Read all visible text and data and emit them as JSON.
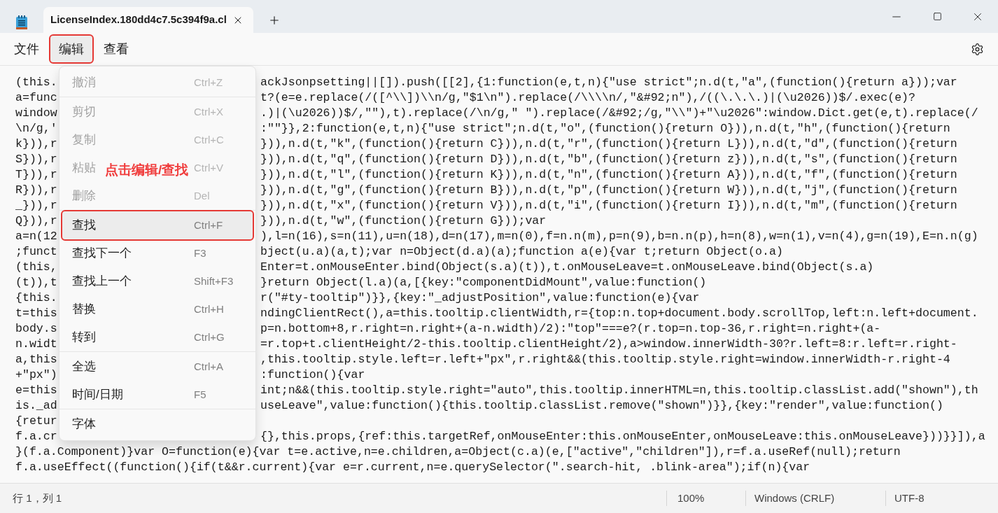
{
  "window": {
    "tab_title": "LicenseIndex.180dd4c7.5c394f9a.cl"
  },
  "menu_bar": [
    {
      "label": "文件",
      "selected": false,
      "annotated": false
    },
    {
      "label": "编辑",
      "selected": true,
      "annotated": true
    },
    {
      "label": "查看",
      "selected": false,
      "annotated": false
    }
  ],
  "edit_menu": {
    "groups": [
      [
        {
          "label": "撤消",
          "shortcut": "Ctrl+Z",
          "disabled": true,
          "selected": false,
          "annotated": false
        }
      ],
      [
        {
          "label": "剪切",
          "shortcut": "Ctrl+X",
          "disabled": true,
          "selected": false,
          "annotated": false
        },
        {
          "label": "复制",
          "shortcut": "Ctrl+C",
          "disabled": true,
          "selected": false,
          "annotated": false
        },
        {
          "label": "粘贴",
          "shortcut": "Ctrl+V",
          "disabled": true,
          "selected": false,
          "annotated": false
        },
        {
          "label": "删除",
          "shortcut": "Del",
          "disabled": true,
          "selected": false,
          "annotated": false
        }
      ],
      [
        {
          "label": "查找",
          "shortcut": "Ctrl+F",
          "disabled": false,
          "selected": true,
          "annotated": true
        },
        {
          "label": "查找下一个",
          "shortcut": "F3",
          "disabled": false,
          "selected": false,
          "annotated": false
        },
        {
          "label": "查找上一个",
          "shortcut": "Shift+F3",
          "disabled": false,
          "selected": false,
          "annotated": false
        },
        {
          "label": "替换",
          "shortcut": "Ctrl+H",
          "disabled": false,
          "selected": false,
          "annotated": false
        },
        {
          "label": "转到",
          "shortcut": "Ctrl+G",
          "disabled": false,
          "selected": false,
          "annotated": false
        }
      ],
      [
        {
          "label": "全选",
          "shortcut": "Ctrl+A",
          "disabled": false,
          "selected": false,
          "annotated": false
        },
        {
          "label": "时间/日期",
          "shortcut": "F5",
          "disabled": false,
          "selected": false,
          "annotated": false
        }
      ],
      [
        {
          "label": "字体",
          "disabled": false,
          "selected": false,
          "annotated": false
        }
      ]
    ]
  },
  "annotation": "点击编辑/查找",
  "editor_lines": [
    {
      "kind": "split",
      "left": "(this.",
      "right": "ackJsonpsetting||[]).push([[2],{1:function(e,t,n){\"use strict\";n.d(t,\"a\",(function(){return a}));var"
    },
    {
      "kind": "split",
      "left": "a=func",
      "right": "t?(e=e.replace(/([^\\\\])\\\\n/g,\"$1\\n\").replace(/\\\\\\\\n/,\"&#92;n\"),/((\\.\\.\\.)|(\\u2026))$/.exec(e)?"
    },
    {
      "kind": "split",
      "left": "window",
      "right": ".)|(\\u2026))$/,\"\"),t).replace(/\\n/g,\" \").replace(/&#92;/g,\"\\\\\")+\"\\u2026\":window.Dict.get(e,t).replace(/"
    },
    {
      "kind": "split",
      "left": "\\n/g,'",
      "right": ":\"\"}},2:function(e,t,n){\"use strict\";n.d(t,\"o\",(function(){return O})),n.d(t,\"h\",(function(){return"
    },
    {
      "kind": "split",
      "left": "k})),r",
      "right": "})),n.d(t,\"k\",(function(){return C})),n.d(t,\"r\",(function(){return L})),n.d(t,\"d\",(function(){return"
    },
    {
      "kind": "split",
      "left": "S})),r",
      "right": "})),n.d(t,\"q\",(function(){return D})),n.d(t,\"b\",(function(){return z})),n.d(t,\"s\",(function(){return"
    },
    {
      "kind": "split",
      "left": "T})),r",
      "right": "})),n.d(t,\"l\",(function(){return K})),n.d(t,\"n\",(function(){return A})),n.d(t,\"f\",(function(){return"
    },
    {
      "kind": "split",
      "left": "R})),r",
      "right": "})),n.d(t,\"g\",(function(){return B})),n.d(t,\"p\",(function(){return W})),n.d(t,\"j\",(function(){return"
    },
    {
      "kind": "split",
      "left": "_})),r",
      "right": "})),n.d(t,\"x\",(function(){return V})),n.d(t,\"i\",(function(){return I})),n.d(t,\"m\",(function(){return"
    },
    {
      "kind": "split",
      "left": "Q})),r",
      "right": "})),n.d(t,\"w\",(function(){return G}));var"
    },
    {
      "kind": "split",
      "left": "a=n(12",
      "right": "),l=n(16),s=n(11),u=n(18),d=n(17),m=n(0),f=n.n(m),p=n(9),b=n.n(p),h=n(8),w=n(1),v=n(4),g=n(19),E=n.n(g)"
    },
    {
      "kind": "split",
      "left": ";funct",
      "right": "bject(u.a)(a,t);var n=Object(d.a)(a);function a(e){var t;return Object(o.a)"
    },
    {
      "kind": "split",
      "left": "(this,",
      "right": "Enter=t.onMouseEnter.bind(Object(s.a)(t)),t.onMouseLeave=t.onMouseLeave.bind(Object(s.a)"
    },
    {
      "kind": "split",
      "left": "(t)),t",
      "right": "}return Object(l.a)(a,[{key:\"componentDidMount\",value:function()"
    },
    {
      "kind": "split",
      "left": "{this.",
      "right": "r(\"#ty-tooltip\")}},{key:\"_adjustPosition\",value:function(e){var"
    },
    {
      "kind": "split",
      "left": "t=this",
      "right": "ndingClientRect(),a=this.tooltip.clientWidth,r={top:n.top+document.body.scrollTop,left:n.left+document."
    },
    {
      "kind": "split",
      "left": "body.s",
      "right": "p=n.bottom+8,r.right=n.right+(a-n.width)/2):\"top\"===e?(r.top=n.top-36,r.right=n.right+(a-"
    },
    {
      "kind": "split",
      "left": "n.widt",
      "right": "=r.top+t.clientHeight/2-this.tooltip.clientHeight/2),a>window.innerWidth-30?r.left=8:r.left=r.right-"
    },
    {
      "kind": "split",
      "left": "a,this",
      "right": ",this.tooltip.style.left=r.left+\"px\",r.right&&(this.tooltip.style.right=window.innerWidth-r.right-4"
    },
    {
      "kind": "split",
      "left": "+\"px\")",
      "right": ":function(){var"
    },
    {
      "kind": "split",
      "left": "e=this",
      "right": "int;n&&(this.tooltip.style.right=\"auto\",this.tooltip.innerHTML=n,this.tooltip.classList.add(\"shown\"),th"
    },
    {
      "kind": "split",
      "left": "is._ad",
      "right": "useLeave\",value:function(){this.tooltip.classList.remove(\"shown\")}},{key:\"render\",value:function()"
    },
    {
      "kind": "split",
      "left": "{retur"
    },
    {
      "kind": "split",
      "left": "f.a.cr",
      "right": "{},this.props,{ref:this.targetRef,onMouseEnter:this.onMouseEnter,onMouseLeave:this.onMouseLeave}))}}]),a"
    },
    {
      "kind": "full",
      "text": "}(f.a.Component)}var O=function(e){var t=e.active,n=e.children,a=Object(c.a)(e,[\"active\",\"children\"]),r=f.a.useRef(null);return"
    },
    {
      "kind": "full",
      "text": "f.a.useEffect((function(){if(t&&r.current){var e=r.current,n=e.querySelector(\".search-hit, .blink-area\");if(n){var"
    }
  ],
  "status_bar": {
    "position": "行 1，列 1",
    "zoom": "100%",
    "line_ending": "Windows (CRLF)",
    "encoding": "UTF-8"
  }
}
